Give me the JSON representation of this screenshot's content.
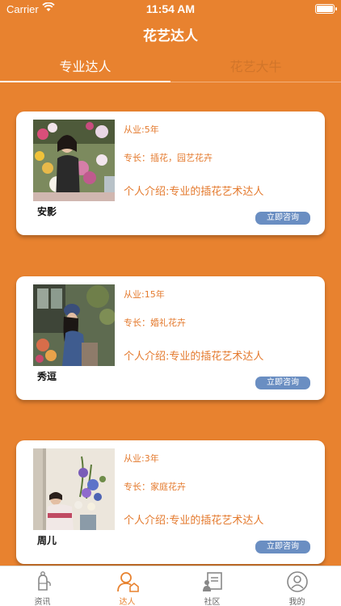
{
  "status_bar": {
    "carrier": "Carrier",
    "time": "11:54 AM"
  },
  "nav": {
    "title": "花艺达人"
  },
  "tabs": [
    {
      "label": "专业达人",
      "active": true
    },
    {
      "label": "花艺大牛",
      "active": false
    }
  ],
  "experts": [
    {
      "name": "安影",
      "years": "从业:5年",
      "specialty": "专长：插花，园艺花卉",
      "intro": "个人介绍:专业的插花艺术达人",
      "button": "立即咨询"
    },
    {
      "name": "秀逗",
      "years": "从业:15年",
      "specialty": "专长：婚礼花卉",
      "intro": "个人介绍:专业的插花艺术达人",
      "button": "立即咨询"
    },
    {
      "name": "周儿",
      "years": "从业:3年",
      "specialty": "专长：家庭花卉",
      "intro": "个人介绍:专业的插花艺术达人",
      "button": "立即咨询"
    }
  ],
  "tabbar": [
    {
      "label": "资讯",
      "icon": "news-icon",
      "active": false
    },
    {
      "label": "达人",
      "icon": "expert-icon",
      "active": true
    },
    {
      "label": "社区",
      "icon": "community-icon",
      "active": false
    },
    {
      "label": "我的",
      "icon": "profile-icon",
      "active": false
    }
  ],
  "colors": {
    "accent": "#E8822F",
    "button": "#6A8EC2",
    "text_accent": "#E47A2E"
  }
}
